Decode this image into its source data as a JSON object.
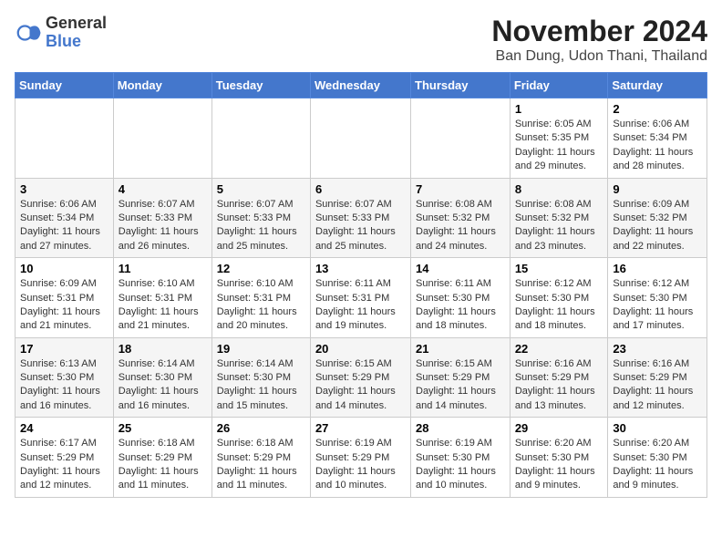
{
  "header": {
    "logo_general": "General",
    "logo_blue": "Blue",
    "month_title": "November 2024",
    "location": "Ban Dung, Udon Thani, Thailand"
  },
  "days_of_week": [
    "Sunday",
    "Monday",
    "Tuesday",
    "Wednesday",
    "Thursday",
    "Friday",
    "Saturday"
  ],
  "weeks": [
    {
      "days": [
        {
          "num": "",
          "info": ""
        },
        {
          "num": "",
          "info": ""
        },
        {
          "num": "",
          "info": ""
        },
        {
          "num": "",
          "info": ""
        },
        {
          "num": "",
          "info": ""
        },
        {
          "num": "1",
          "info": "Sunrise: 6:05 AM\nSunset: 5:35 PM\nDaylight: 11 hours and 29 minutes."
        },
        {
          "num": "2",
          "info": "Sunrise: 6:06 AM\nSunset: 5:34 PM\nDaylight: 11 hours and 28 minutes."
        }
      ]
    },
    {
      "days": [
        {
          "num": "3",
          "info": "Sunrise: 6:06 AM\nSunset: 5:34 PM\nDaylight: 11 hours and 27 minutes."
        },
        {
          "num": "4",
          "info": "Sunrise: 6:07 AM\nSunset: 5:33 PM\nDaylight: 11 hours and 26 minutes."
        },
        {
          "num": "5",
          "info": "Sunrise: 6:07 AM\nSunset: 5:33 PM\nDaylight: 11 hours and 25 minutes."
        },
        {
          "num": "6",
          "info": "Sunrise: 6:07 AM\nSunset: 5:33 PM\nDaylight: 11 hours and 25 minutes."
        },
        {
          "num": "7",
          "info": "Sunrise: 6:08 AM\nSunset: 5:32 PM\nDaylight: 11 hours and 24 minutes."
        },
        {
          "num": "8",
          "info": "Sunrise: 6:08 AM\nSunset: 5:32 PM\nDaylight: 11 hours and 23 minutes."
        },
        {
          "num": "9",
          "info": "Sunrise: 6:09 AM\nSunset: 5:32 PM\nDaylight: 11 hours and 22 minutes."
        }
      ]
    },
    {
      "days": [
        {
          "num": "10",
          "info": "Sunrise: 6:09 AM\nSunset: 5:31 PM\nDaylight: 11 hours and 21 minutes."
        },
        {
          "num": "11",
          "info": "Sunrise: 6:10 AM\nSunset: 5:31 PM\nDaylight: 11 hours and 21 minutes."
        },
        {
          "num": "12",
          "info": "Sunrise: 6:10 AM\nSunset: 5:31 PM\nDaylight: 11 hours and 20 minutes."
        },
        {
          "num": "13",
          "info": "Sunrise: 6:11 AM\nSunset: 5:31 PM\nDaylight: 11 hours and 19 minutes."
        },
        {
          "num": "14",
          "info": "Sunrise: 6:11 AM\nSunset: 5:30 PM\nDaylight: 11 hours and 18 minutes."
        },
        {
          "num": "15",
          "info": "Sunrise: 6:12 AM\nSunset: 5:30 PM\nDaylight: 11 hours and 18 minutes."
        },
        {
          "num": "16",
          "info": "Sunrise: 6:12 AM\nSunset: 5:30 PM\nDaylight: 11 hours and 17 minutes."
        }
      ]
    },
    {
      "days": [
        {
          "num": "17",
          "info": "Sunrise: 6:13 AM\nSunset: 5:30 PM\nDaylight: 11 hours and 16 minutes."
        },
        {
          "num": "18",
          "info": "Sunrise: 6:14 AM\nSunset: 5:30 PM\nDaylight: 11 hours and 16 minutes."
        },
        {
          "num": "19",
          "info": "Sunrise: 6:14 AM\nSunset: 5:30 PM\nDaylight: 11 hours and 15 minutes."
        },
        {
          "num": "20",
          "info": "Sunrise: 6:15 AM\nSunset: 5:29 PM\nDaylight: 11 hours and 14 minutes."
        },
        {
          "num": "21",
          "info": "Sunrise: 6:15 AM\nSunset: 5:29 PM\nDaylight: 11 hours and 14 minutes."
        },
        {
          "num": "22",
          "info": "Sunrise: 6:16 AM\nSunset: 5:29 PM\nDaylight: 11 hours and 13 minutes."
        },
        {
          "num": "23",
          "info": "Sunrise: 6:16 AM\nSunset: 5:29 PM\nDaylight: 11 hours and 12 minutes."
        }
      ]
    },
    {
      "days": [
        {
          "num": "24",
          "info": "Sunrise: 6:17 AM\nSunset: 5:29 PM\nDaylight: 11 hours and 12 minutes."
        },
        {
          "num": "25",
          "info": "Sunrise: 6:18 AM\nSunset: 5:29 PM\nDaylight: 11 hours and 11 minutes."
        },
        {
          "num": "26",
          "info": "Sunrise: 6:18 AM\nSunset: 5:29 PM\nDaylight: 11 hours and 11 minutes."
        },
        {
          "num": "27",
          "info": "Sunrise: 6:19 AM\nSunset: 5:29 PM\nDaylight: 11 hours and 10 minutes."
        },
        {
          "num": "28",
          "info": "Sunrise: 6:19 AM\nSunset: 5:30 PM\nDaylight: 11 hours and 10 minutes."
        },
        {
          "num": "29",
          "info": "Sunrise: 6:20 AM\nSunset: 5:30 PM\nDaylight: 11 hours and 9 minutes."
        },
        {
          "num": "30",
          "info": "Sunrise: 6:20 AM\nSunset: 5:30 PM\nDaylight: 11 hours and 9 minutes."
        }
      ]
    }
  ]
}
